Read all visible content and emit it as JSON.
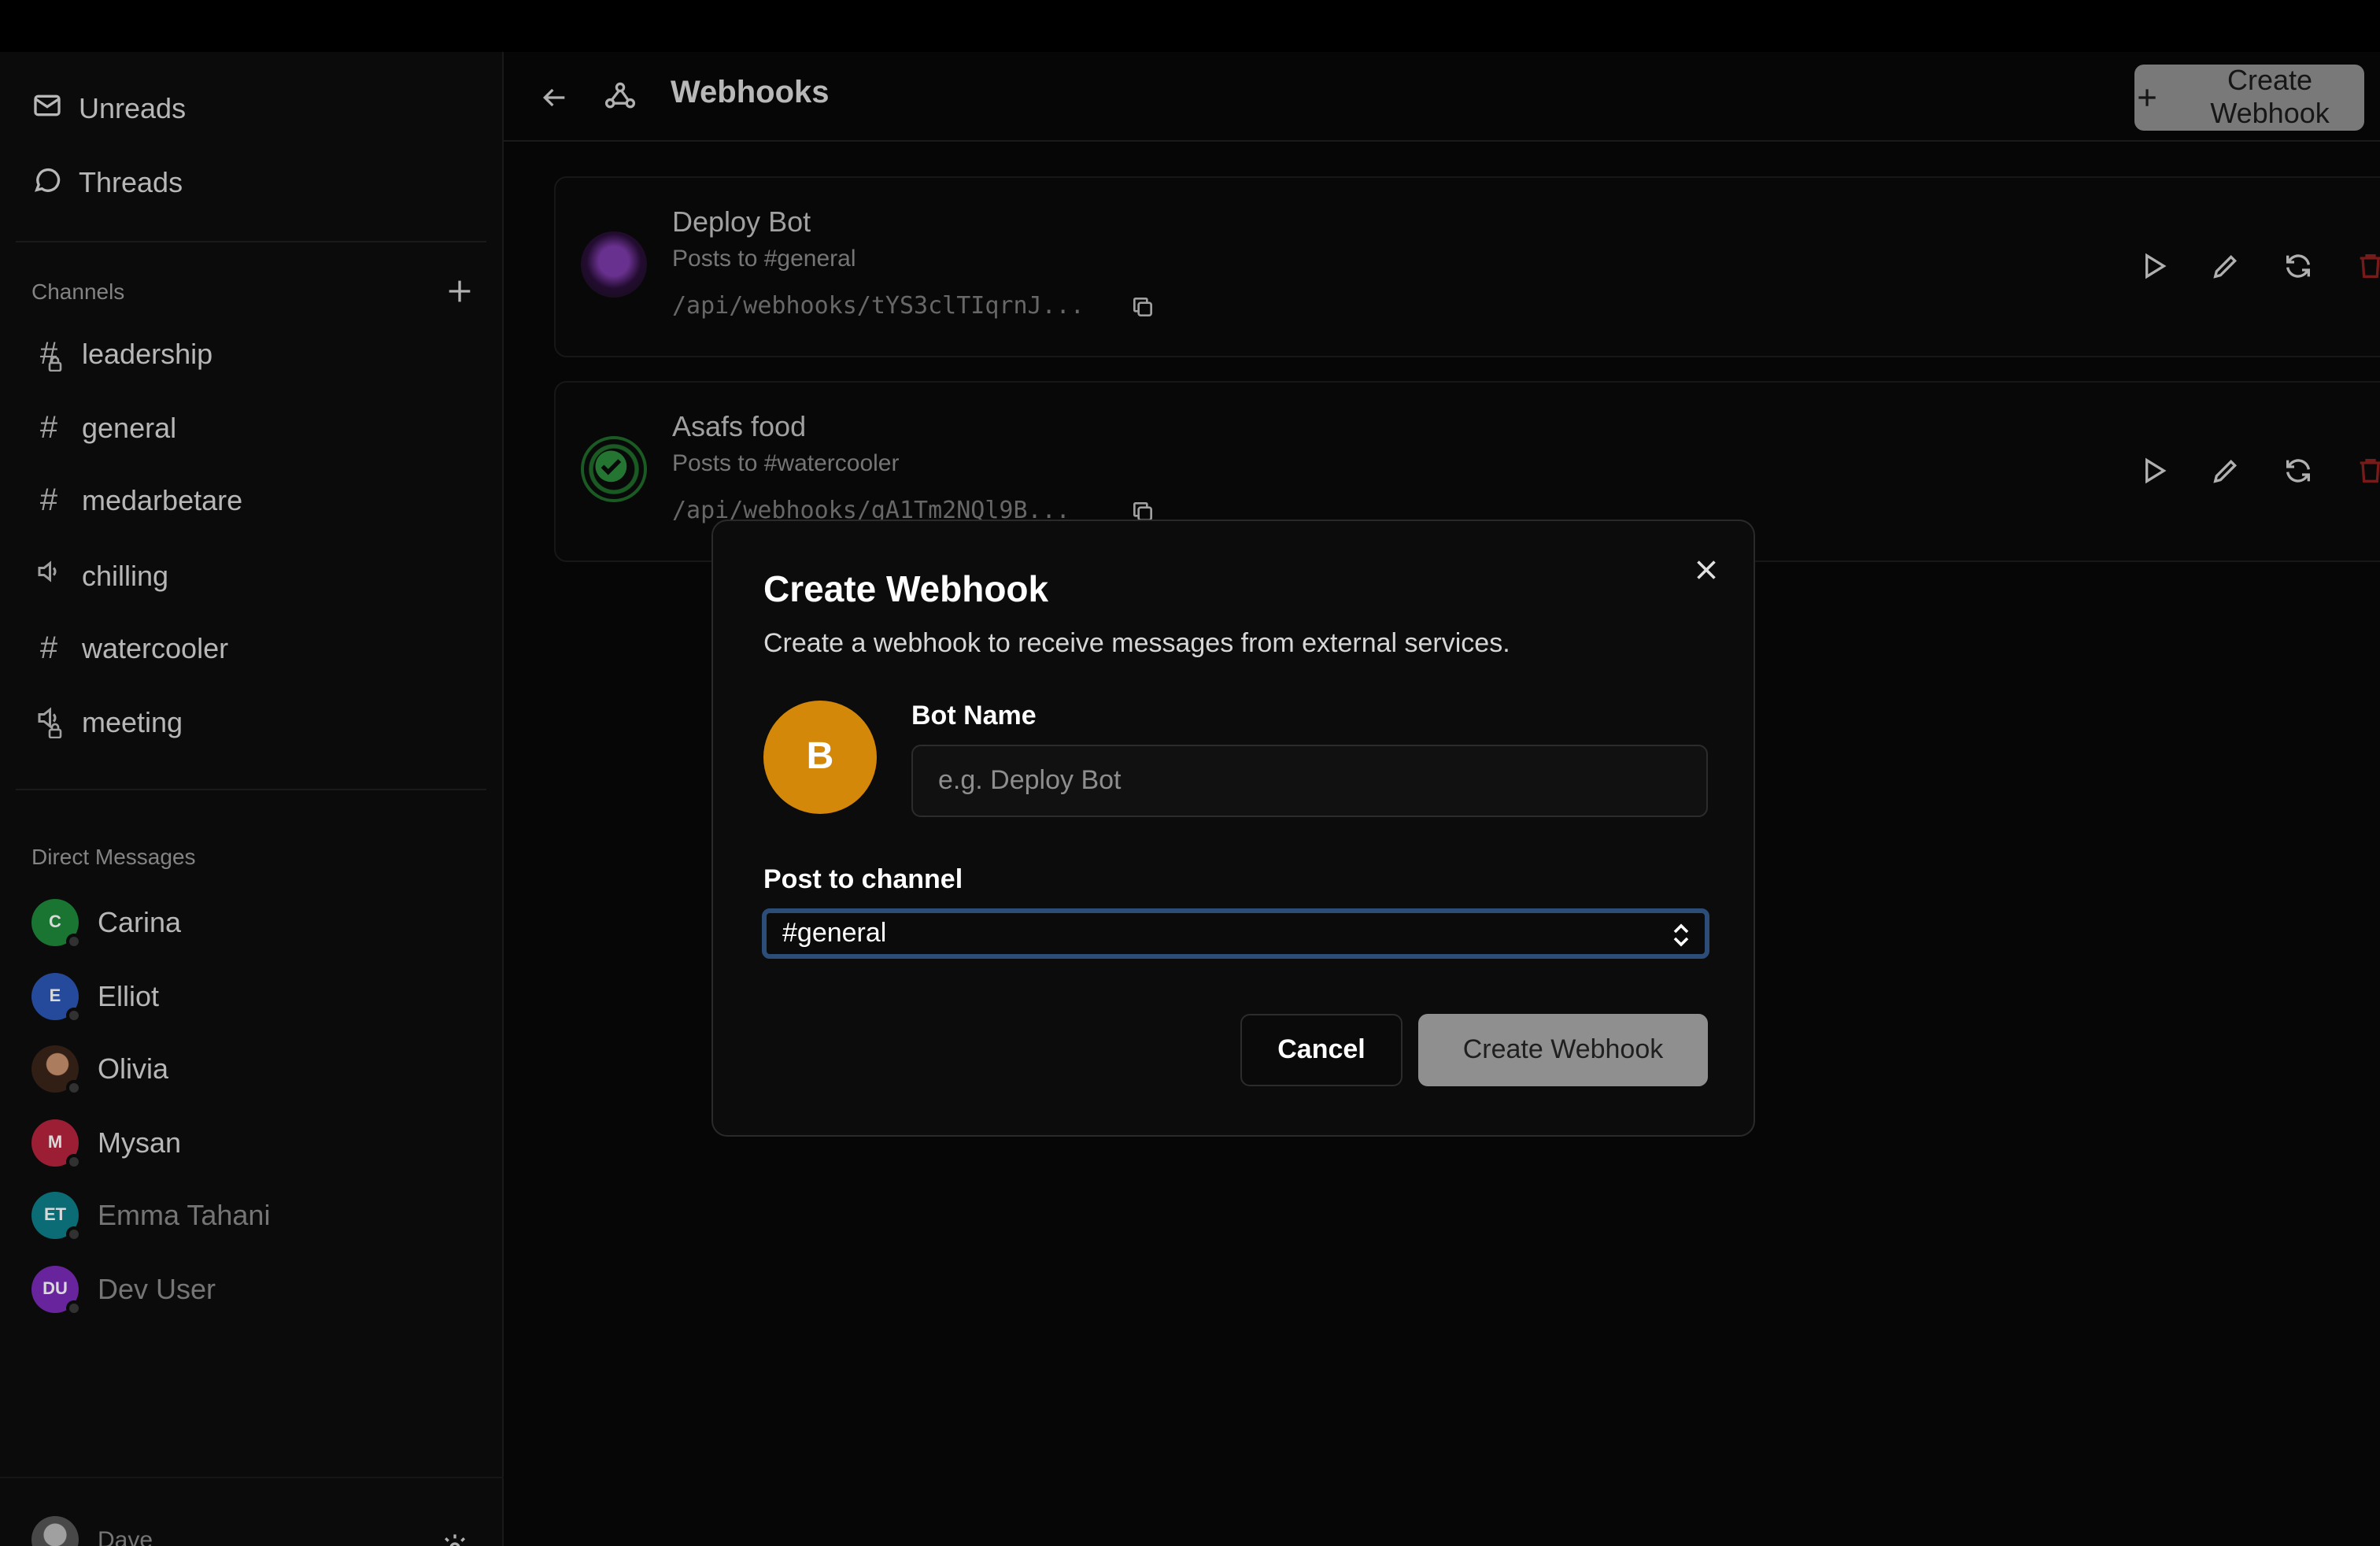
{
  "sidebar": {
    "nav": [
      {
        "label": "Unreads",
        "icon": "mail-icon"
      },
      {
        "label": "Threads",
        "icon": "chat-bubble-icon"
      }
    ],
    "channels_title": "Channels",
    "channels": [
      {
        "name": "leadership",
        "icon": "hash-lock-icon"
      },
      {
        "name": "general",
        "icon": "hash-icon"
      },
      {
        "name": "medarbetare",
        "icon": "hash-icon"
      },
      {
        "name": "chilling",
        "icon": "speaker-icon"
      },
      {
        "name": "watercooler",
        "icon": "hash-icon"
      },
      {
        "name": "meeting",
        "icon": "speaker-lock-icon"
      }
    ],
    "dm_title": "Direct Messages",
    "dms": [
      {
        "name": "Carina",
        "initials": "C",
        "color": "#1e8a3a"
      },
      {
        "name": "Elliot",
        "initials": "E",
        "color": "#2c58b8"
      },
      {
        "name": "Olivia",
        "initials": "",
        "color": "#5a3a2a"
      },
      {
        "name": "Mysan",
        "initials": "M",
        "color": "#b8243e"
      },
      {
        "name": "Emma Tahani",
        "initials": "ET",
        "color": "#0e7f8a"
      },
      {
        "name": "Dev User",
        "initials": "DU",
        "color": "#7a2bb8"
      }
    ],
    "user": {
      "name": "Dave"
    }
  },
  "header": {
    "title": "Webhooks",
    "create_label": "Create Webhook"
  },
  "webhooks": [
    {
      "name": "Deploy Bot",
      "target": "Posts to #general",
      "url": "/api/webhooks/tYS3clTIqrnJ..."
    },
    {
      "name": "Asafs food",
      "target": "Posts to #watercooler",
      "url": "/api/webhooks/gA1Tm2NQl9B..."
    }
  ],
  "modal": {
    "title": "Create Webhook",
    "description": "Create a webhook to receive messages from external services.",
    "avatar_letter": "B",
    "avatar_color": "#d4880a",
    "bot_name_label": "Bot Name",
    "bot_name_placeholder": "e.g. Deploy Bot",
    "bot_name_value": "",
    "channel_label": "Post to channel",
    "channel_value": "#general",
    "cancel_label": "Cancel",
    "submit_label": "Create Webhook"
  }
}
